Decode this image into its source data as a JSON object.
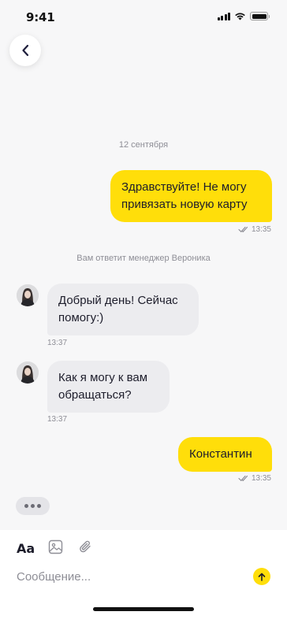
{
  "status_bar": {
    "time": "9:41"
  },
  "chat": {
    "date": "12 сентября",
    "system_note": "Вам ответит менеджер Вероника",
    "messages": [
      {
        "direction": "out",
        "text": "Здравствуйте! Не могу привязать новую карту",
        "time": "13:35",
        "read": true
      },
      {
        "direction": "in",
        "text": "Добрый день! Сейчас помогу:)",
        "time": "13:37"
      },
      {
        "direction": "in",
        "text": "Как я могу к вам обращаться?",
        "time": "13:37"
      },
      {
        "direction": "out",
        "text": "Константин",
        "time": "13:35",
        "read": true
      }
    ],
    "typing_indicator": "•••"
  },
  "composer": {
    "format_label": "Aa",
    "placeholder": "Сообщение...",
    "icons": [
      "image-icon",
      "paperclip-icon",
      "send-arrow-icon"
    ]
  },
  "colors": {
    "accent": "#ffde0a",
    "incoming_bubble": "#ececef",
    "background": "#f7f7f8",
    "muted_text": "#8e8e96"
  }
}
